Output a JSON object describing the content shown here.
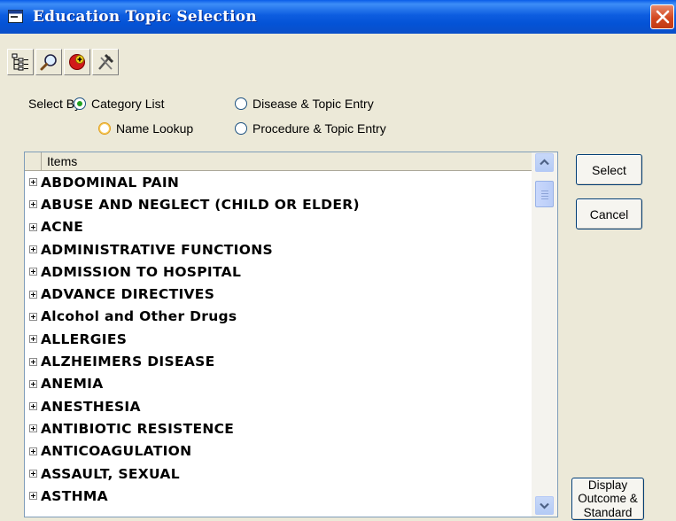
{
  "window": {
    "title": "Education Topic Selection",
    "close_icon": "close-x-icon"
  },
  "toolbar": {
    "buttons": [
      {
        "icon": "tree-view-icon"
      },
      {
        "icon": "magnifier-icon"
      },
      {
        "icon": "add-item-icon"
      },
      {
        "icon": "tools-icon"
      }
    ]
  },
  "select_by": {
    "label": "Select By",
    "options": [
      {
        "label": "Category List",
        "selected": true
      },
      {
        "label": "Disease & Topic Entry",
        "selected": false
      },
      {
        "label": "Name Lookup",
        "selected": false,
        "focused": true
      },
      {
        "label": "Procedure & Topic Entry",
        "selected": false
      }
    ]
  },
  "list": {
    "header": "Items",
    "items": [
      "ABDOMINAL PAIN",
      "ABUSE AND NEGLECT (CHILD OR ELDER)",
      "ACNE",
      "ADMINISTRATIVE FUNCTIONS",
      "ADMISSION TO HOSPITAL",
      "ADVANCE DIRECTIVES",
      "Alcohol and Other Drugs",
      "ALLERGIES",
      "ALZHEIMERS DISEASE",
      "ANEMIA",
      "ANESTHESIA",
      "ANTIBIOTIC RESISTENCE",
      "ANTICOAGULATION",
      "ASSAULT, SEXUAL",
      "ASTHMA"
    ]
  },
  "buttons": {
    "select": "Select",
    "cancel": "Cancel",
    "display_line1": "Display",
    "display_line2": "Outcome &",
    "display_line3": "Standard"
  }
}
